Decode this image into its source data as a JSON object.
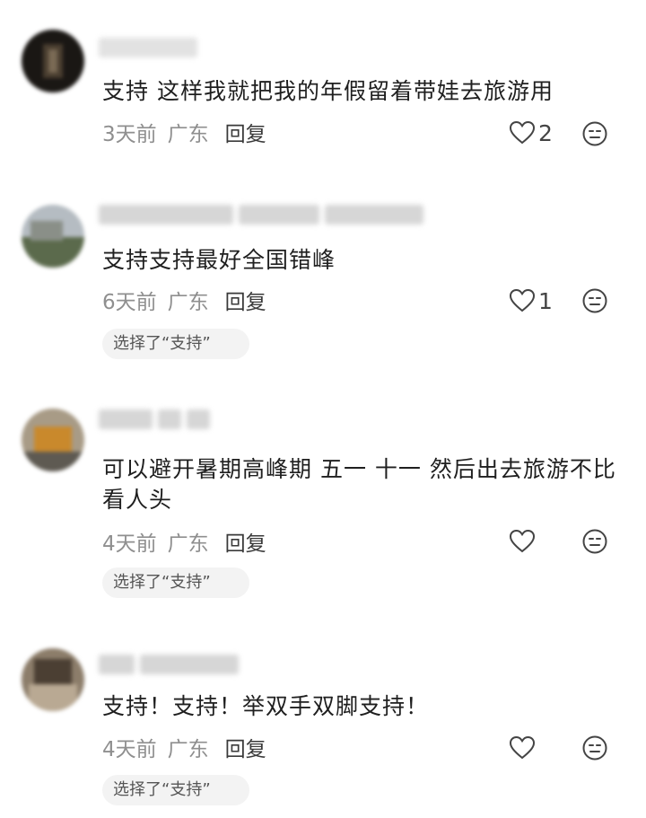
{
  "comments": [
    {
      "text": "支持 这样我就把我的年假留着带娃去旅游用",
      "time": "3天前",
      "region": "广东",
      "reply": "回复",
      "likes": "2",
      "selection": ""
    },
    {
      "text": "支持支持最好全国错峰",
      "time": "6天前",
      "region": "广东",
      "reply": "回复",
      "likes": "1",
      "selection": "选择了“支持”"
    },
    {
      "text": "可以避开暑期高峰期 五一 十一 然后出去旅游不比看人头",
      "time": "4天前",
      "region": "广东",
      "reply": "回复",
      "likes": "",
      "selection": "选择了“支持”"
    },
    {
      "text": "支持！支持！举双手双脚支持！",
      "time": "4天前",
      "region": "广东",
      "reply": "回复",
      "likes": "",
      "selection": "选择了“支持”"
    }
  ],
  "icons": {
    "like": "heart-outline-icon",
    "emoji": "neutral-face-icon"
  },
  "colors": {
    "text": "#1f1f1f",
    "meta": "#8f8f8f",
    "chip_bg": "#f3f3f3"
  }
}
